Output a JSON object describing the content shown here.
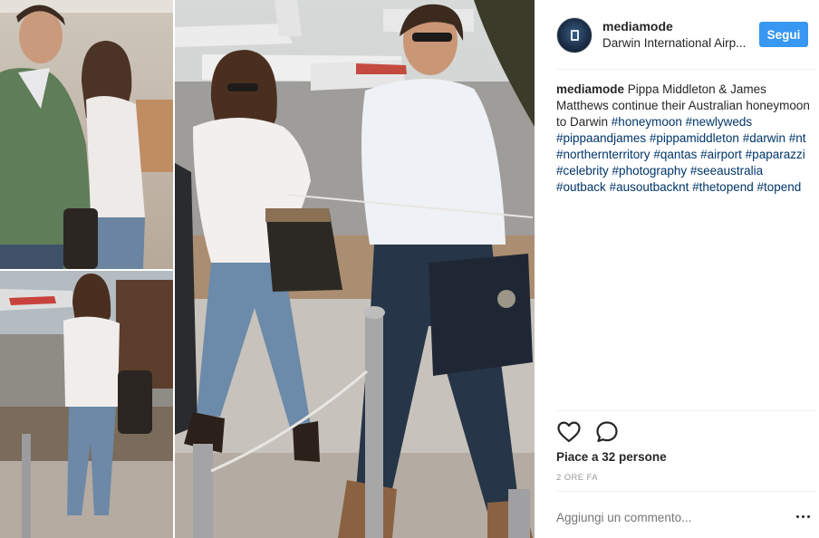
{
  "post": {
    "username": "mediamode",
    "location": "Darwin International Airp...",
    "follow_label": "Segui",
    "caption_user": "mediamode",
    "caption_text": "Pippa Middleton & James Matthews continue their Australian honeymoon to Darwin",
    "hashtags": [
      "#honeymoon",
      "#newlyweds",
      "#pippaandjames",
      "#pippamiddleton",
      "#darwin",
      "#nt",
      "#northernterritory",
      "#qantas",
      "#airport",
      "#paparazzi",
      "#celebrity",
      "#photography",
      "#seeaustralia",
      "#outback",
      "#ausoutbacknt",
      "#thetopend",
      "#topend"
    ],
    "likes": "Piace a 32 persone",
    "time_ago": "2 ORE FA",
    "comment_placeholder": "Aggiungi un commento..."
  },
  "icons": {
    "like": "heart-icon",
    "comment": "comment-icon",
    "more": "more-options-icon",
    "avatar": "profile-avatar"
  },
  "colors": {
    "follow_button": "#3897f0",
    "hashtag": "#003569",
    "muted": "#999999"
  }
}
